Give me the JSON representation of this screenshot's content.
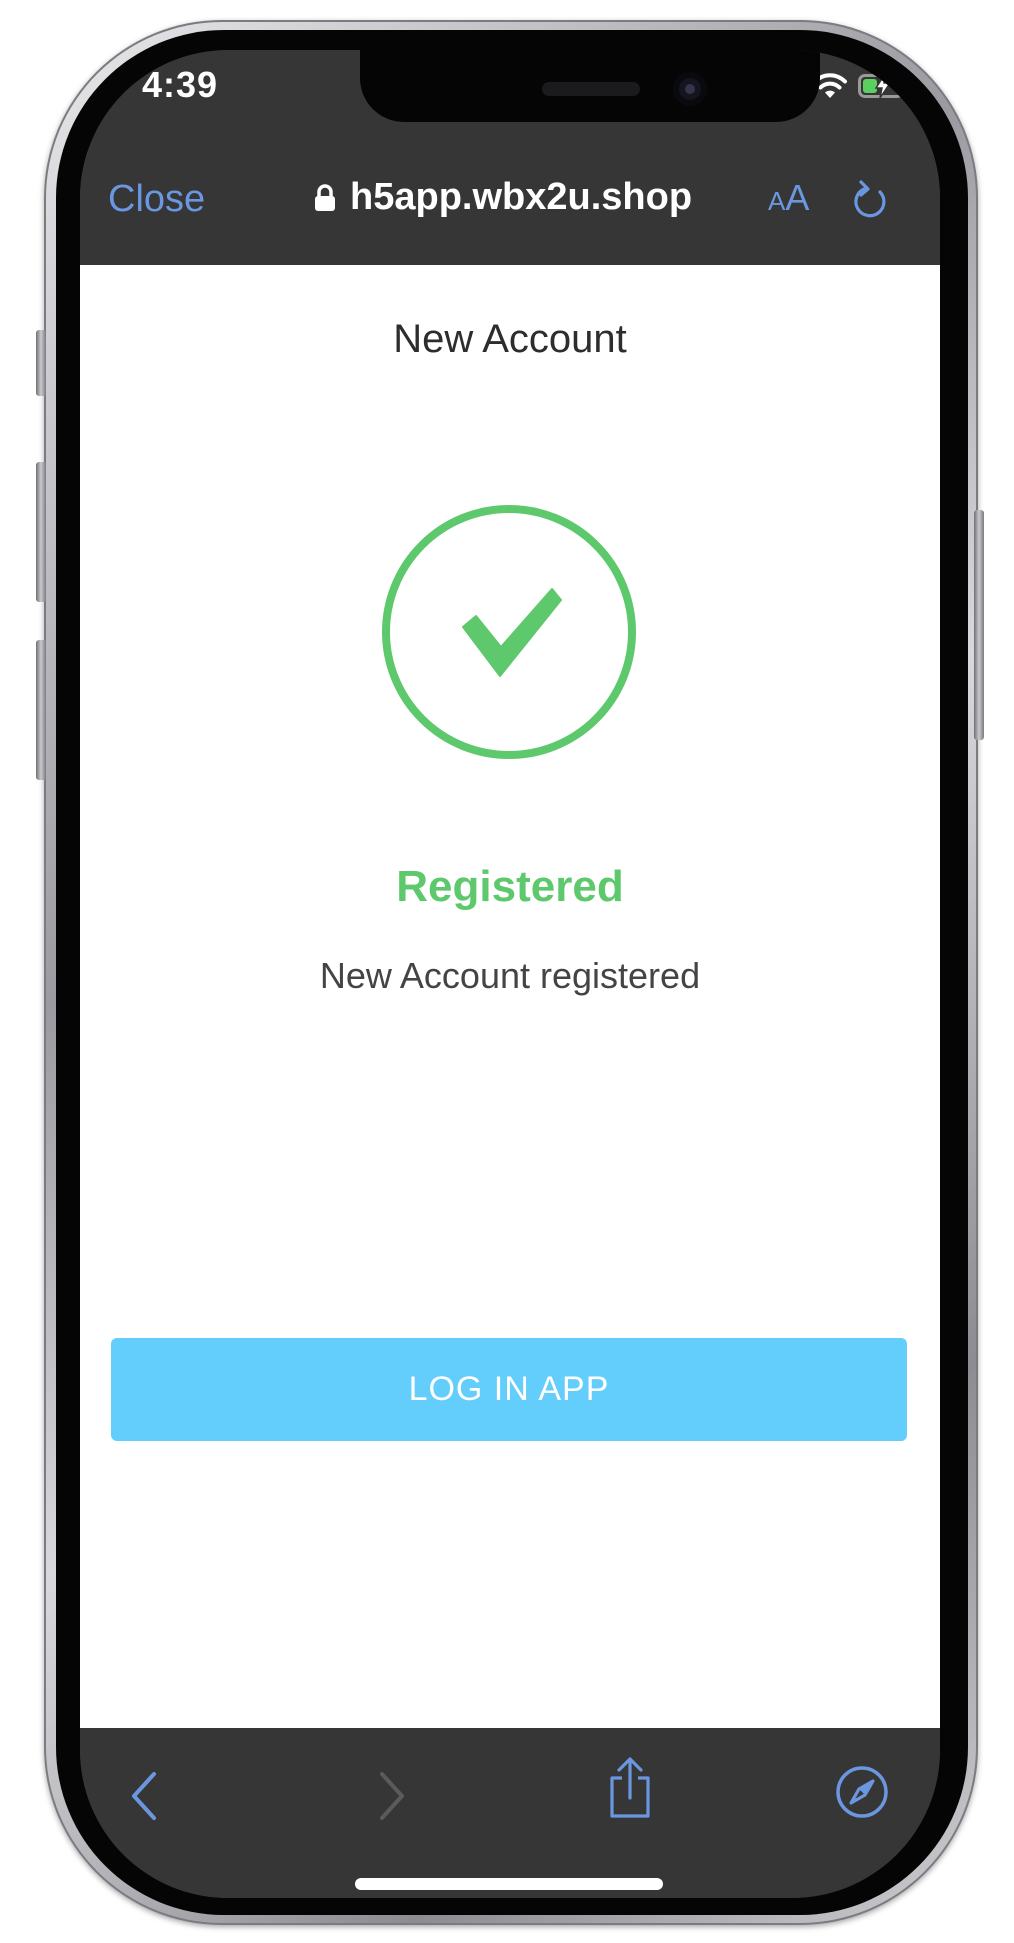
{
  "status_bar": {
    "time": "4:39"
  },
  "browser": {
    "close_label": "Close",
    "url": "h5app.wbx2u.shop",
    "text_size_small": "A",
    "text_size_large": "A"
  },
  "page": {
    "title": "New Account",
    "status_heading": "Registered",
    "status_message": "New Account registered",
    "login_button": "LOG IN APP"
  },
  "icons": {
    "lock": "lock-icon",
    "reload": "reload-icon",
    "success": "checkmark-circle-icon",
    "back": "chevron-left-icon",
    "forward": "chevron-right-icon",
    "share": "share-icon",
    "compass": "compass-icon"
  },
  "colors": {
    "accent_blue": "#6b96e0",
    "success_green": "#5ec86c",
    "button_blue": "#63cdfc",
    "browser_chrome": "#363636"
  }
}
